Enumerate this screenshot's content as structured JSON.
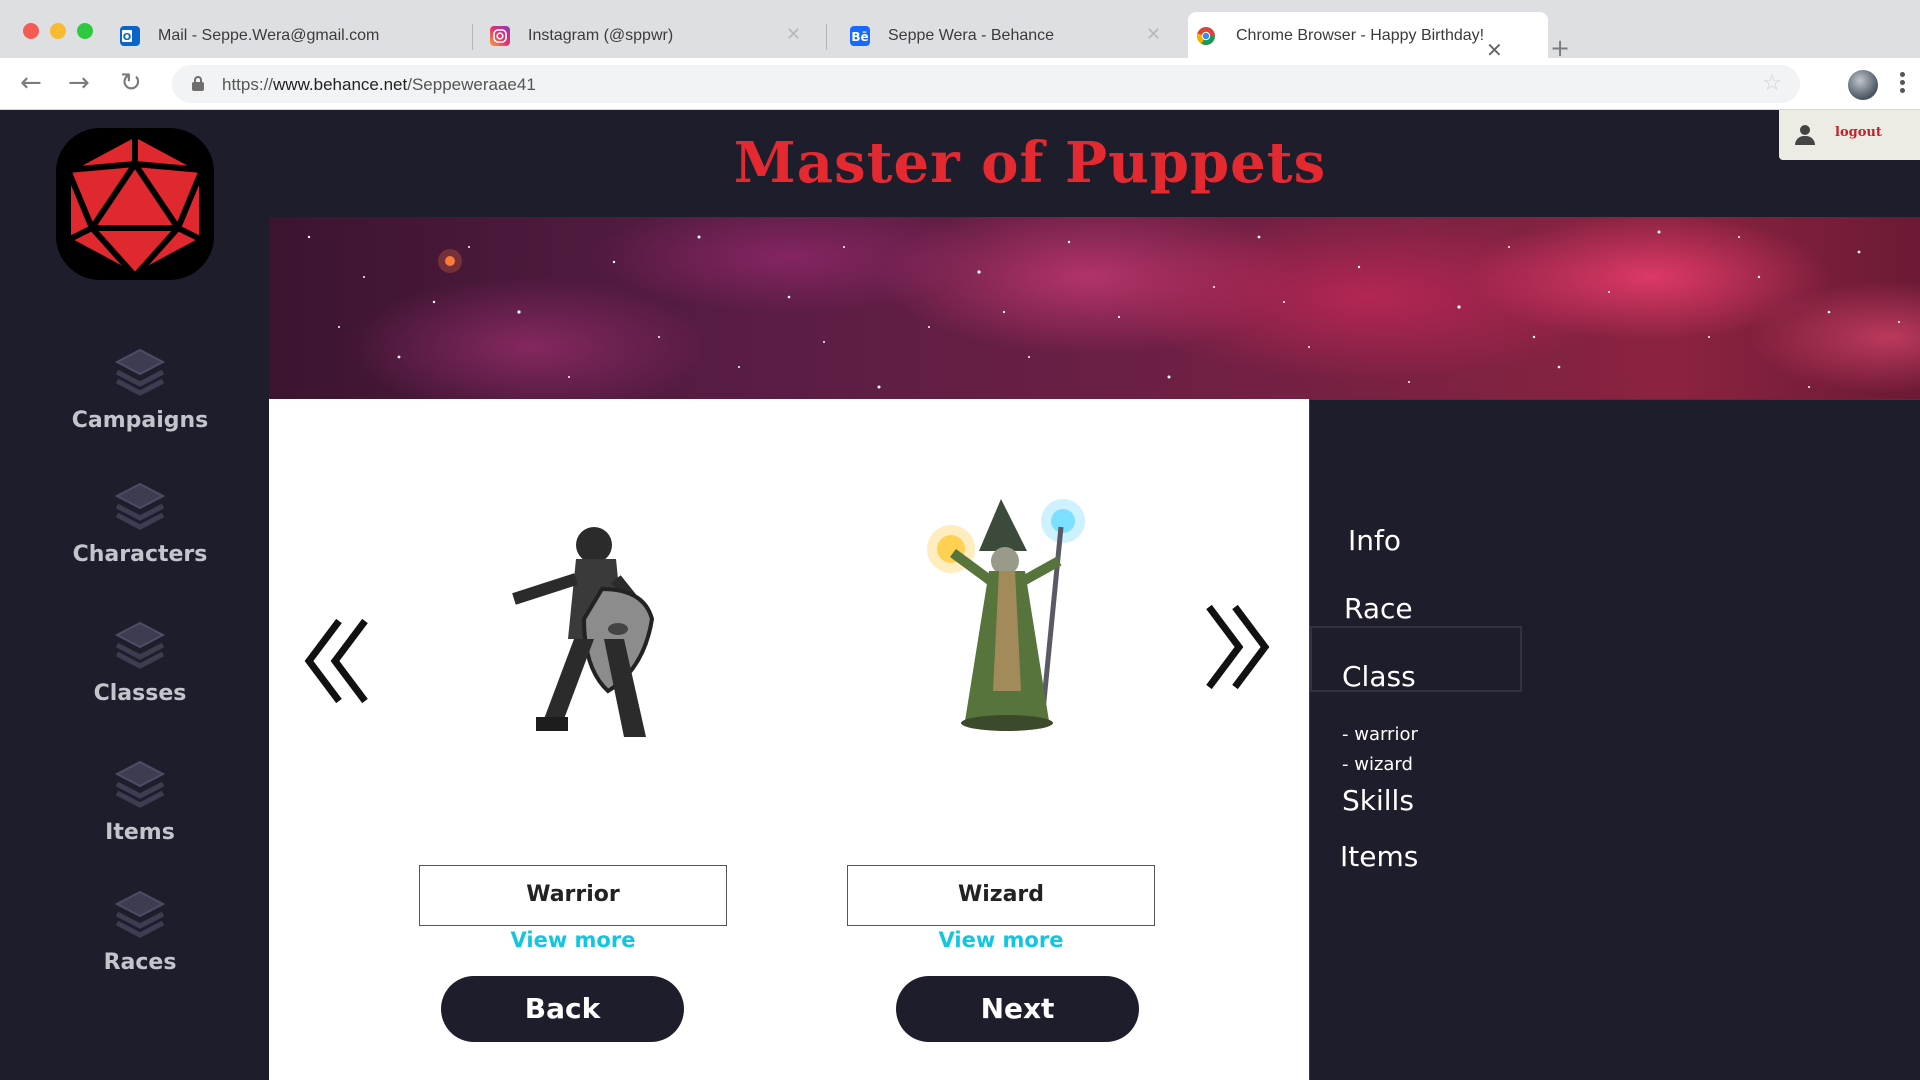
{
  "browser": {
    "tabs": [
      {
        "title": "Mail - Seppe.Wera@gmail.com",
        "icon": "outlook-icon"
      },
      {
        "title": "Instagram (@sppwr)",
        "icon": "instagram-icon"
      },
      {
        "title": "Seppe Wera - Behance",
        "icon": "behance-icon"
      },
      {
        "title": "Chrome Browser - Happy Birthday!",
        "icon": "chrome-icon",
        "active": true
      }
    ],
    "url_prefix": "https://",
    "url_domain": "www.behance.net",
    "url_path": "/Seppeweraae41"
  },
  "app": {
    "title": "Master of Puppets",
    "logout_label": "logout",
    "accent_color": "#e42a30",
    "link_color": "#12c6e0",
    "sidebar": [
      {
        "label": "Campaigns"
      },
      {
        "label": "Characters"
      },
      {
        "label": "Classes"
      },
      {
        "label": "Items"
      },
      {
        "label": "Races"
      }
    ],
    "cards": [
      {
        "name": "Warrior",
        "link": "View more"
      },
      {
        "name": "Wizard",
        "link": "View more"
      }
    ],
    "buttons": {
      "back": "Back",
      "next": "Next"
    },
    "steps": {
      "info": "Info",
      "race": "Race",
      "class": "Class",
      "class_items": [
        "- warrior",
        "- wizard"
      ],
      "skills": "Skills",
      "items": "Items",
      "active": "Class"
    }
  }
}
